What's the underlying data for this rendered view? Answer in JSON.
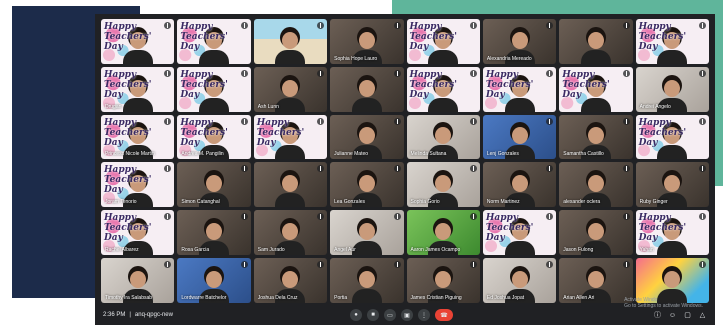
{
  "window": {
    "time": "2:36 PM",
    "meeting_code": "anq-qpgc-new",
    "separator": "|"
  },
  "greeting": "Happy\nTeachers'\nDay",
  "activate_windows": {
    "title": "Activate Windows",
    "subtitle": "Go to Settings to activate Windows."
  },
  "participants": [
    {
      "name": "",
      "bg": "teachers"
    },
    {
      "name": "",
      "bg": "teachers"
    },
    {
      "name": "",
      "bg": "beach"
    },
    {
      "name": "Sophia Hope Lauro",
      "bg": "room"
    },
    {
      "name": "",
      "bg": "teachers"
    },
    {
      "name": "Alexandria Mereado",
      "bg": "room"
    },
    {
      "name": "",
      "bg": "room"
    },
    {
      "name": "",
      "bg": "teachers"
    },
    {
      "name": "Drugan",
      "bg": "teachers"
    },
    {
      "name": "",
      "bg": "teachers"
    },
    {
      "name": "Ash Lunn",
      "bg": "room"
    },
    {
      "name": "",
      "bg": "room"
    },
    {
      "name": "",
      "bg": "teachers"
    },
    {
      "name": "",
      "bg": "teachers"
    },
    {
      "name": "",
      "bg": "teachers"
    },
    {
      "name": "Andrei Angelo",
      "bg": "light"
    },
    {
      "name": "Princess Nicole Martin",
      "bg": "teachers"
    },
    {
      "name": "Andrea M. Pangilin",
      "bg": "teachers"
    },
    {
      "name": "",
      "bg": "teachers"
    },
    {
      "name": "Julianne Mateo",
      "bg": "room"
    },
    {
      "name": "Melinda Sultana",
      "bg": "light"
    },
    {
      "name": "Lenj Gonzales",
      "bg": "blue"
    },
    {
      "name": "Samantha Castillo",
      "bg": "room"
    },
    {
      "name": "",
      "bg": "teachers"
    },
    {
      "name": "Joram Tenorio",
      "bg": "teachers"
    },
    {
      "name": "Simon Catanghal",
      "bg": "room"
    },
    {
      "name": "",
      "bg": "room"
    },
    {
      "name": "Lea Gonzales",
      "bg": "room"
    },
    {
      "name": "Sophia Gorio",
      "bg": "light"
    },
    {
      "name": "Norm Martinez",
      "bg": "room"
    },
    {
      "name": "alexander oclera",
      "bg": "room"
    },
    {
      "name": "Ruby Ginger",
      "bg": "room"
    },
    {
      "name": "Rachel Albarez",
      "bg": "teachers"
    },
    {
      "name": "Rosa Garcia",
      "bg": "room"
    },
    {
      "name": "Sam Jurado",
      "bg": "room"
    },
    {
      "name": "Angel Aur",
      "bg": "light"
    },
    {
      "name": "Aaron James Ocampo",
      "bg": "green"
    },
    {
      "name": "",
      "bg": "teachers"
    },
    {
      "name": "Jason Fulong",
      "bg": "room"
    },
    {
      "name": "Yahan",
      "bg": "teachers"
    },
    {
      "name": "Timothy Ira Salabsab",
      "bg": "light"
    },
    {
      "name": "Lordwarre Batchelor",
      "bg": "blue"
    },
    {
      "name": "Joshua Dela Cruz",
      "bg": "room"
    },
    {
      "name": "Portia",
      "bg": "room"
    },
    {
      "name": "James Cristian Piguing",
      "bg": "room"
    },
    {
      "name": "Ed Joshua Jopat",
      "bg": "light"
    },
    {
      "name": "Arian Allen Ari",
      "bg": "room"
    },
    {
      "name": "",
      "bg": "colorful"
    }
  ]
}
